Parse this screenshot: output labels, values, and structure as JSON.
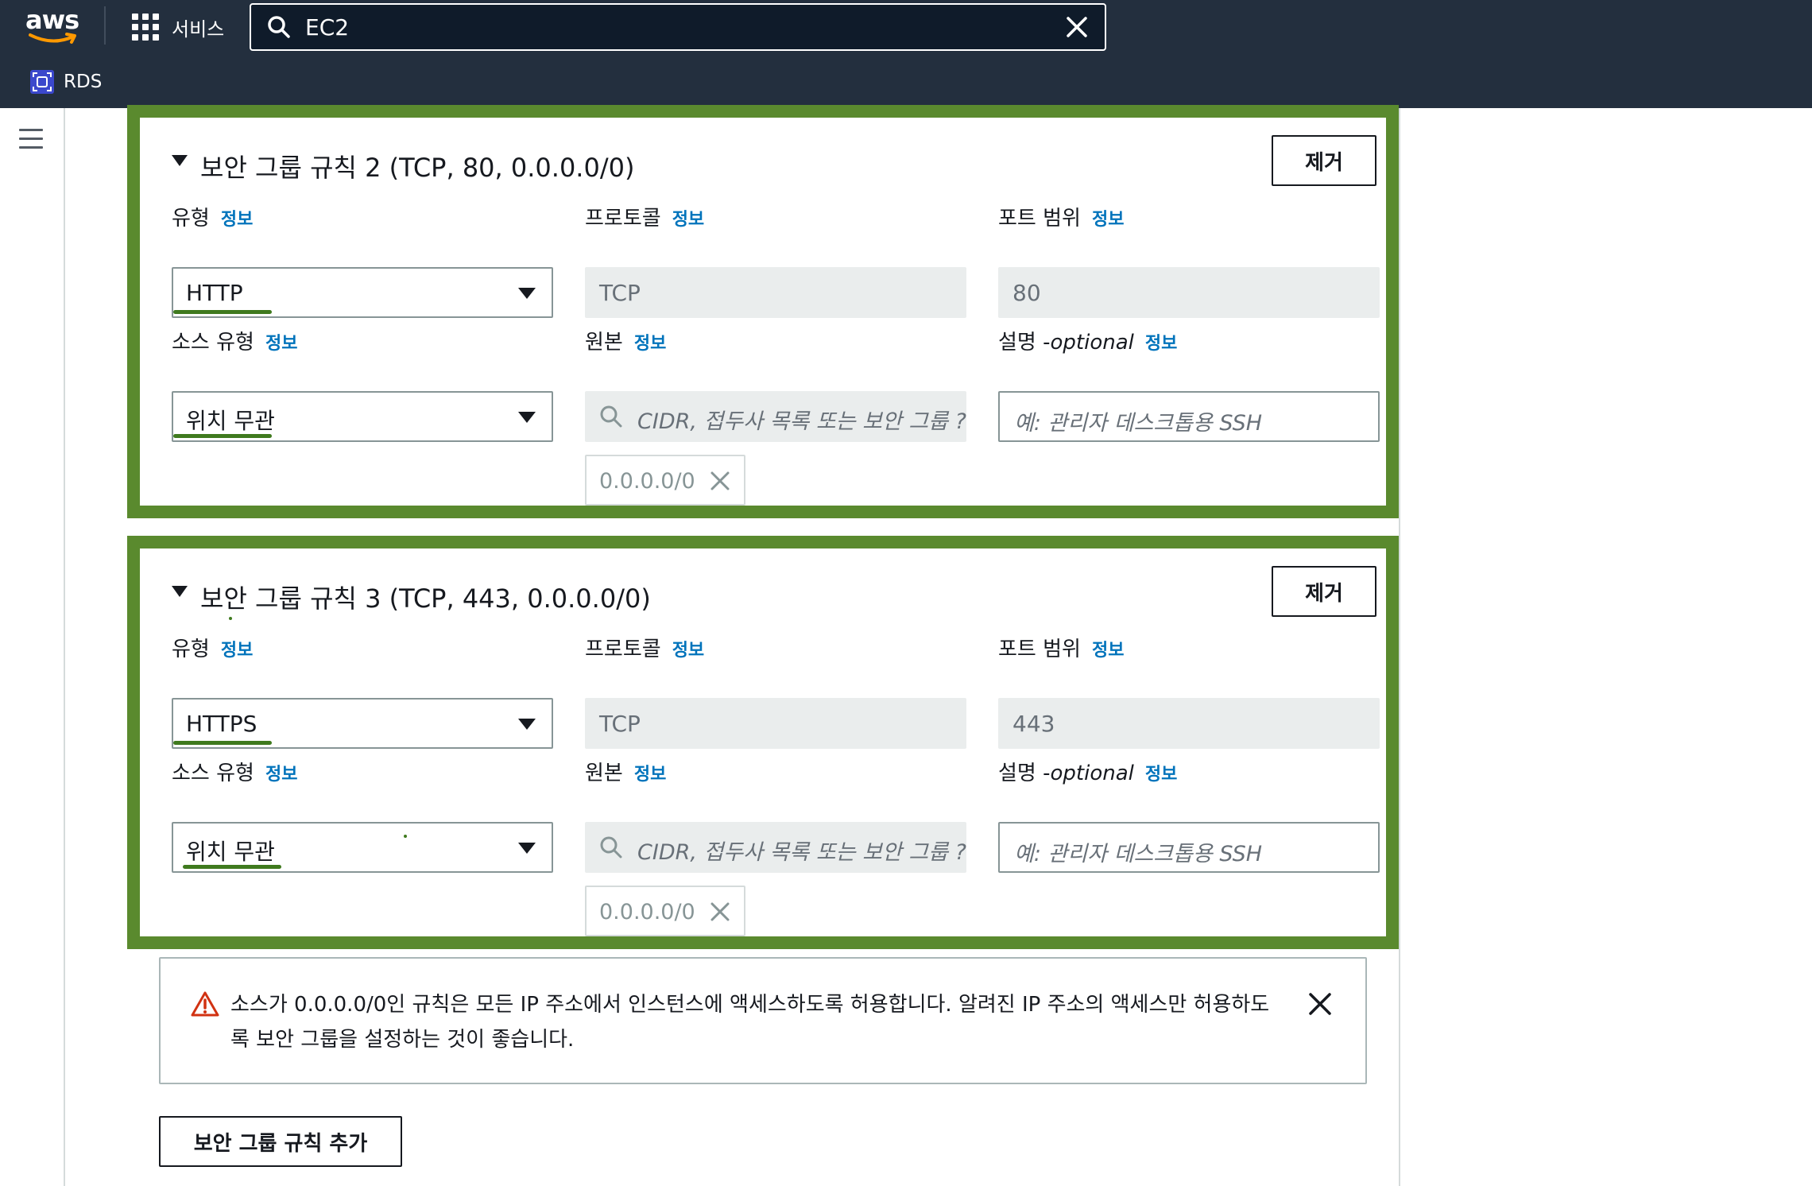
{
  "topnav": {
    "logo_text": "aws",
    "services_label": "서비스",
    "search_value": "EC2",
    "favorites": [
      {
        "label": "RDS",
        "icon": "rds-icon"
      }
    ],
    "bg_color": "#232f3e"
  },
  "rules": [
    {
      "title": "보안 그룹 규칙 2 (TCP, 80, 0.0.0.0/0)",
      "remove_label": "제거",
      "type_label": "유형",
      "type_value": "HTTP",
      "protocol_label": "프로토콜",
      "protocol_value": "TCP",
      "port_label": "포트 범위",
      "port_value": "80",
      "source_type_label": "소스 유형",
      "source_type_value": "위치 무관",
      "source_label": "원본",
      "source_placeholder": "CIDR, 접두사 목록 또는 보안 그룹 ?",
      "source_token": "0.0.0.0/0",
      "desc_label": "설명 - ",
      "desc_optional": "optional",
      "desc_placeholder": "예: 관리자 데스크톱용 SSH",
      "info": "정보"
    },
    {
      "title": "보안 그룹 규칙 3 (TCP, 443, 0.0.0.0/0)",
      "remove_label": "제거",
      "type_label": "유형",
      "type_value": "HTTPS",
      "protocol_label": "프로토콜",
      "protocol_value": "TCP",
      "port_label": "포트 범위",
      "port_value": "443",
      "source_type_label": "소스 유형",
      "source_type_value": "위치 무관",
      "source_label": "원본",
      "source_placeholder": "CIDR, 접두사 목록 또는 보안 그룹 ?",
      "source_token": "0.0.0.0/0",
      "desc_label": "설명 - ",
      "desc_optional": "optional",
      "desc_placeholder": "예: 관리자 데스크톱용 SSH",
      "info": "정보"
    }
  ],
  "warning": {
    "text": "소스가 0.0.0.0/0인 규칙은 모든 IP 주소에서 인스턴스에 액세스하도록 허용합니다. 알려진 IP 주소의 액세스만 허용하도록 보안 그룹을 설정하는 것이 좋습니다.",
    "icon": "warning-triangle-icon"
  },
  "add_rule_label": "보안 그룹 규칙 추가",
  "colors": {
    "highlight_border": "#5a8a2e",
    "info_link": "#0073bb",
    "warning_icon": "#d13212"
  }
}
